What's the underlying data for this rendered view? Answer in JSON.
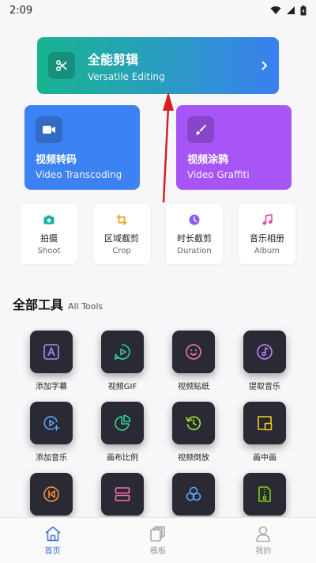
{
  "status_bar": {
    "time": "2:09"
  },
  "hero": {
    "title": "全能剪辑",
    "subtitle": "Versatile Editing",
    "icon": "scissors-icon"
  },
  "feature_cards": [
    {
      "title": "视频转码",
      "subtitle": "Video Transcoding",
      "icon": "video-camera-icon",
      "color": "#3d82f2"
    },
    {
      "title": "视频涂鸦",
      "subtitle": "Video Graffiti",
      "icon": "brush-icon",
      "color": "#a855f7"
    }
  ],
  "quick_tools": [
    {
      "title": "拍摄",
      "subtitle": "Shoot",
      "icon": "camera-icon",
      "color": "#18b49a"
    },
    {
      "title": "区域截剪",
      "subtitle": "Crop",
      "icon": "crop-icon",
      "color": "#e8a317"
    },
    {
      "title": "时长截剪",
      "subtitle": "Duration",
      "icon": "clock-icon",
      "color": "#8b5cf6"
    },
    {
      "title": "音乐相册",
      "subtitle": "Album",
      "icon": "music-icon",
      "color": "#ec4899"
    }
  ],
  "all_tools": {
    "title_zh": "全部工具",
    "title_en": "All Tools",
    "items": [
      {
        "label": "添加字幕",
        "icon": "subtitle-icon",
        "color": "#a78bfa"
      },
      {
        "label": "视频GIF",
        "icon": "gif-icon",
        "color": "#34d399"
      },
      {
        "label": "视频贴纸",
        "icon": "sticker-icon",
        "color": "#f472b6"
      },
      {
        "label": "提取音乐",
        "icon": "extract-music-icon",
        "color": "#c084fc"
      },
      {
        "label": "添加音乐",
        "icon": "add-music-icon",
        "color": "#60a5fa"
      },
      {
        "label": "画布比例",
        "icon": "canvas-ratio-icon",
        "color": "#34d399"
      },
      {
        "label": "视频倒放",
        "icon": "reverse-icon",
        "color": "#a3e635"
      },
      {
        "label": "画中画",
        "icon": "pip-icon",
        "color": "#facc15"
      },
      {
        "label": "",
        "icon": "rewind-icon",
        "color": "#fb923c"
      },
      {
        "label": "",
        "icon": "split-icon",
        "color": "#f472b6"
      },
      {
        "label": "",
        "icon": "filter-icon",
        "color": "#60a5fa"
      },
      {
        "label": "",
        "icon": "zip-file-icon",
        "color": "#84cc16"
      }
    ]
  },
  "tab_bar": {
    "items": [
      {
        "label": "首页",
        "icon": "home-icon",
        "active": true
      },
      {
        "label": "模板",
        "icon": "template-icon",
        "active": false
      },
      {
        "label": "我的",
        "icon": "profile-icon",
        "active": false
      }
    ]
  }
}
